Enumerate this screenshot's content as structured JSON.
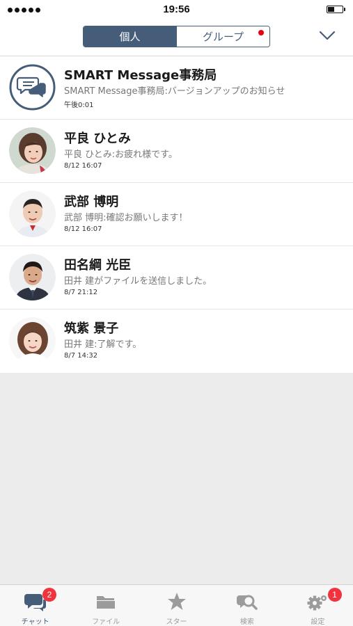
{
  "status_bar": {
    "time": "19:56",
    "battery_level": 0.45
  },
  "header": {
    "segments": [
      {
        "label": "個人",
        "active": true
      },
      {
        "label": "グループ",
        "active": false,
        "unread_dot": true
      }
    ],
    "menu_icon": "chevron-down-icon"
  },
  "chats": [
    {
      "name": "SMART Message事務局",
      "preview": "SMART Message事務局:バージョンアップのお知らせ",
      "time": "午後0:01",
      "avatar": "chat-bubbles-icon"
    },
    {
      "name": "平良 ひとみ",
      "preview": "平良 ひとみ:お疲れ様です。",
      "time": "8/12 16:07",
      "avatar": "woman-photo"
    },
    {
      "name": "武部 博明",
      "preview": "武部 博明:確認お願いします！",
      "time": "8/12 16:07",
      "avatar": "man-photo"
    },
    {
      "name": "田名綱 光臣",
      "preview": "田井 建がファイルを送信しました。",
      "time": "8/7 21:12",
      "avatar": "man-photo"
    },
    {
      "name": "筑紫 景子",
      "preview": "田井 建:了解です。",
      "time": "8/7 14:32",
      "avatar": "woman-photo"
    }
  ],
  "tabs": [
    {
      "label": "チャット",
      "icon": "chat-icon",
      "badge": "2",
      "active": true
    },
    {
      "label": "ファイル",
      "icon": "folder-icon",
      "badge": null,
      "active": false
    },
    {
      "label": "スター",
      "icon": "star-icon",
      "badge": null,
      "active": false
    },
    {
      "label": "検索",
      "icon": "search-icon",
      "badge": null,
      "active": false
    },
    {
      "label": "設定",
      "icon": "gear-icon",
      "badge": "1",
      "active": false
    }
  ],
  "colors": {
    "accent": "#465d79",
    "badge": "#f0333d",
    "unread_dot": "#e60012",
    "empty_background": "#ececec"
  }
}
